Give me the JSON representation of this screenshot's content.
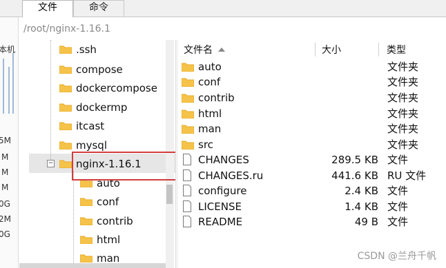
{
  "tabs": [
    {
      "label": "文件",
      "active": true
    },
    {
      "label": "命令",
      "active": false
    }
  ],
  "path": "/root/nginx-1.16.1",
  "left_strip_texts": [
    "本机",
    "5M",
    "M",
    "M",
    "M",
    "0G",
    "2M",
    "0G"
  ],
  "tree": {
    "items": [
      {
        "label": ".ssh",
        "level": 0
      },
      {
        "label": "compose",
        "level": 0
      },
      {
        "label": "dockercompose",
        "level": 0
      },
      {
        "label": "dockermp",
        "level": 0
      },
      {
        "label": "itcast",
        "level": 0
      },
      {
        "label": "mysql",
        "level": 0
      },
      {
        "label": "nginx-1.16.1",
        "level": 0,
        "selected": true,
        "expanded": true
      },
      {
        "label": "auto",
        "level": 1
      },
      {
        "label": "conf",
        "level": 1
      },
      {
        "label": "contrib",
        "level": 1
      },
      {
        "label": "html",
        "level": 1
      },
      {
        "label": "man",
        "level": 1
      }
    ],
    "collapse_symbol": "−"
  },
  "file_list": {
    "columns": {
      "name": "文件名",
      "size": "大小",
      "type": "类型"
    },
    "rows": [
      {
        "name": "auto",
        "size": "",
        "type": "文件夹",
        "kind": "folder"
      },
      {
        "name": "conf",
        "size": "",
        "type": "文件夹",
        "kind": "folder"
      },
      {
        "name": "contrib",
        "size": "",
        "type": "文件夹",
        "kind": "folder"
      },
      {
        "name": "html",
        "size": "",
        "type": "文件夹",
        "kind": "folder"
      },
      {
        "name": "man",
        "size": "",
        "type": "文件夹",
        "kind": "folder"
      },
      {
        "name": "src",
        "size": "",
        "type": "文件夹",
        "kind": "folder"
      },
      {
        "name": "CHANGES",
        "size": "289.5 KB",
        "type": "文件",
        "kind": "file"
      },
      {
        "name": "CHANGES.ru",
        "size": "441.6 KB",
        "type": "RU 文件",
        "kind": "file"
      },
      {
        "name": "configure",
        "size": "2.4 KB",
        "type": "文件",
        "kind": "file"
      },
      {
        "name": "LICENSE",
        "size": "1.4 KB",
        "type": "文件",
        "kind": "file"
      },
      {
        "name": "README",
        "size": "49 B",
        "type": "文件",
        "kind": "file"
      }
    ]
  },
  "watermark": "CSDN @兰舟千帆",
  "colors": {
    "folder": "#f6c34a",
    "folder_dark": "#e6a91e",
    "highlight": "#d23c3c"
  }
}
